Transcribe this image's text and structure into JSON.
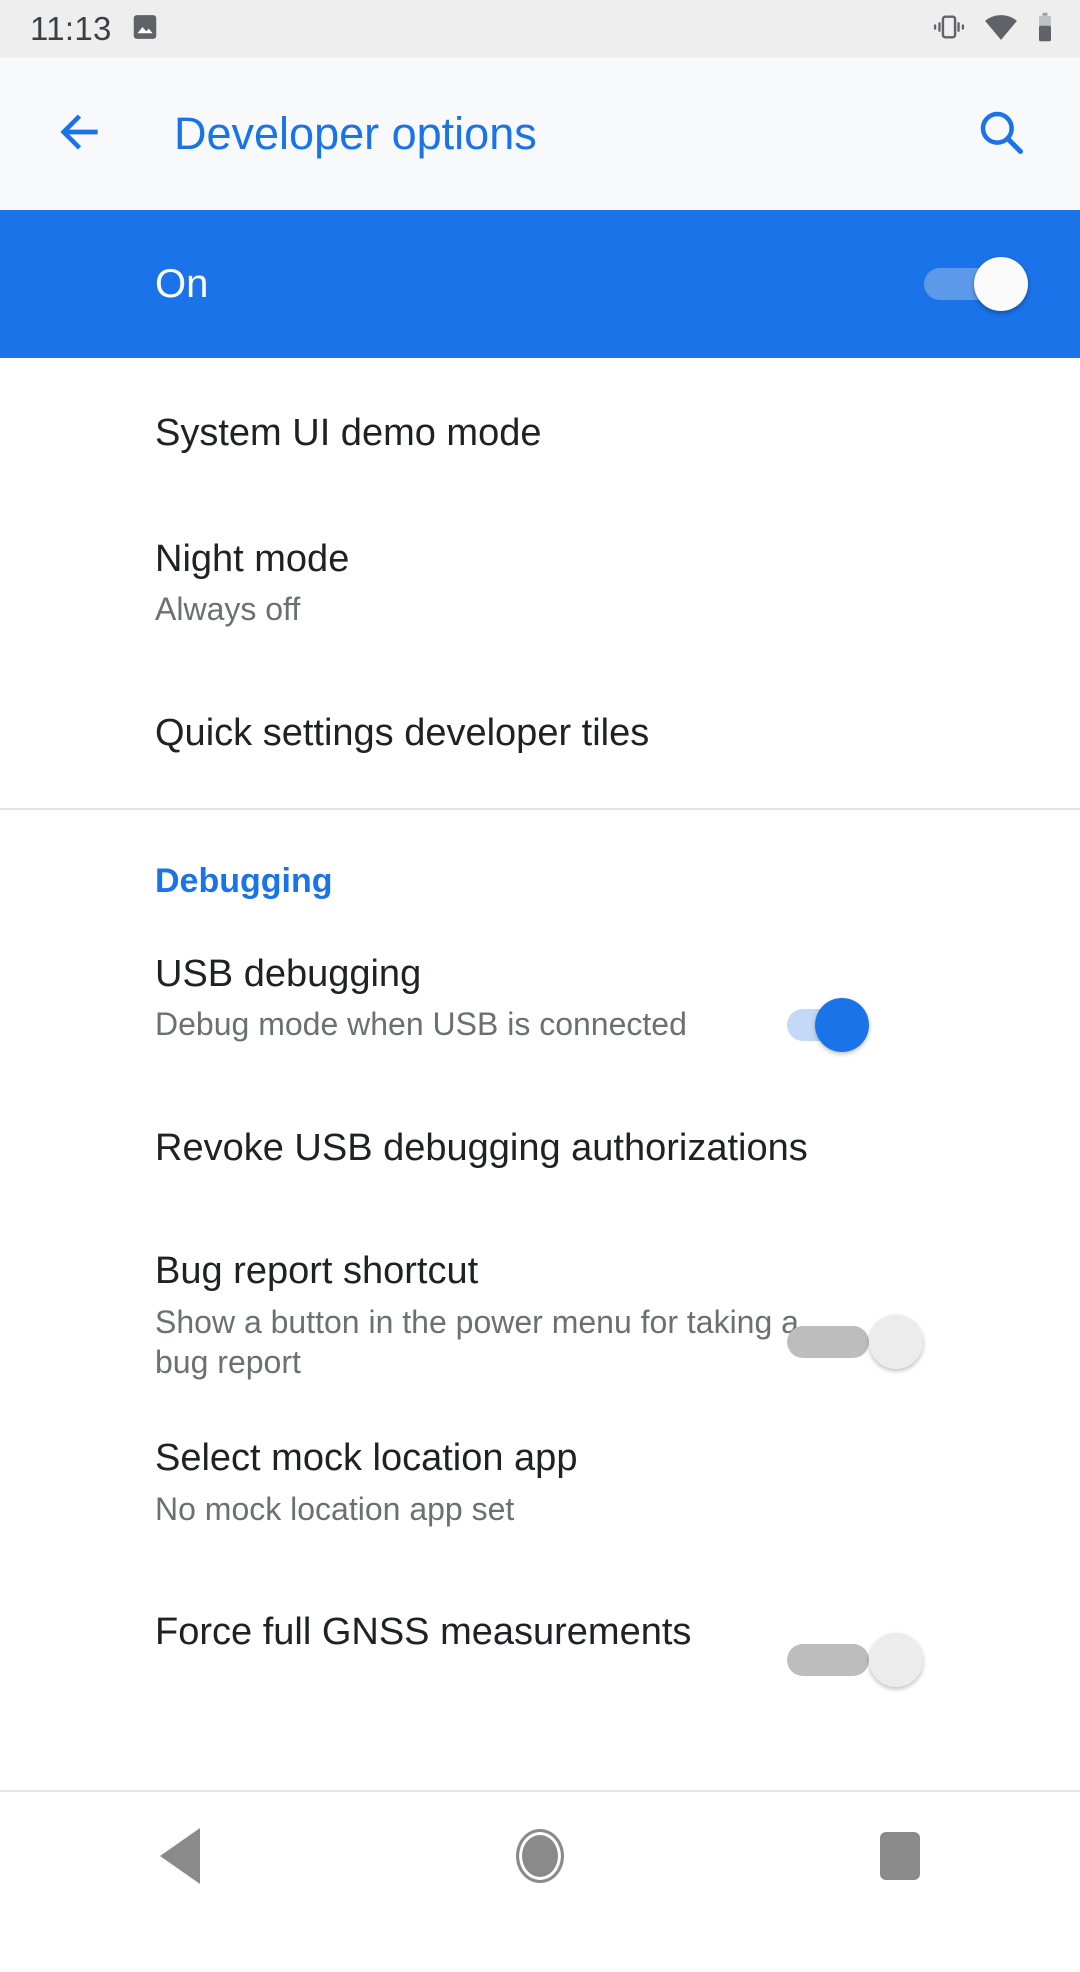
{
  "colors": {
    "accent": "#1a73e8",
    "status_bar_bg": "#eeeeee",
    "app_bar_bg": "#f8f9fa",
    "master_bar_bg": "#1a73e8",
    "primary_text": "#202124",
    "secondary_text": "#6d7073",
    "divider": "#e3e3e3",
    "switch_on_track": "#c3d9f7",
    "switch_off_track": "#bdbdbd",
    "switch_off_thumb": "#ececec",
    "nav_icon": "#8a8a8a"
  },
  "status_bar": {
    "clock": "11:13",
    "left_icons": [
      "image-icon"
    ],
    "right_icons": [
      "vibrate-icon",
      "wifi-icon",
      "battery-icon"
    ]
  },
  "app_bar": {
    "back_icon": "back-arrow-icon",
    "title": "Developer options",
    "search_icon": "search-icon"
  },
  "master_switch": {
    "label": "On",
    "state": "on",
    "icon": "toggle-switch-on"
  },
  "sections": [
    {
      "id": "top",
      "header": null,
      "items": [
        {
          "name": "system-ui-demo-mode",
          "title": "System UI demo mode",
          "subtitle": null,
          "control": null
        },
        {
          "name": "night-mode",
          "title": "Night mode",
          "subtitle": "Always off",
          "control": null
        },
        {
          "name": "quick-settings-developer-tiles",
          "title": "Quick settings developer tiles",
          "subtitle": null,
          "control": null
        }
      ]
    },
    {
      "id": "debugging",
      "header": "Debugging",
      "items": [
        {
          "name": "usb-debugging",
          "title": "USB debugging",
          "subtitle": "Debug mode when USB is connected",
          "control": "switch",
          "control_state": "on"
        },
        {
          "name": "revoke-usb-debugging-authorizations",
          "title": "Revoke USB debugging authorizations",
          "subtitle": null,
          "control": null
        },
        {
          "name": "bug-report-shortcut",
          "title": "Bug report shortcut",
          "subtitle": "Show a button in the power menu for taking a bug report",
          "control": "switch",
          "control_state": "off"
        },
        {
          "name": "select-mock-location-app",
          "title": "Select mock location app",
          "subtitle": "No mock location app set",
          "control": null
        },
        {
          "name": "force-full-gnss-measurements",
          "title": "Force full GNSS measurements",
          "subtitle": null,
          "control": "switch",
          "control_state": "off"
        }
      ]
    }
  ],
  "nav_bar": {
    "back_label": "Back",
    "home_label": "Home",
    "recents_label": "Recents",
    "back_icon": "nav-back-triangle-icon",
    "home_icon": "nav-home-circle-icon",
    "recents_icon": "nav-recents-square-icon"
  }
}
